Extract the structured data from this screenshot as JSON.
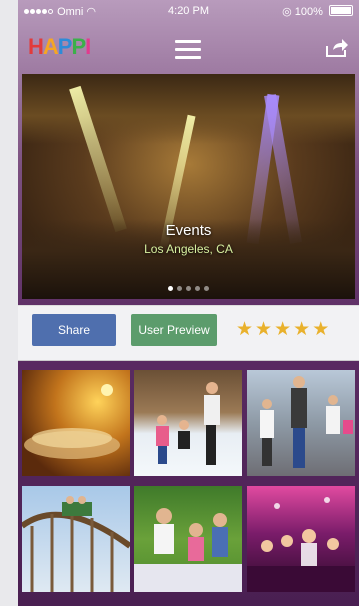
{
  "status": {
    "carrier": "Omni",
    "time": "4:20 PM",
    "battery": "100%"
  },
  "header": {
    "logo_text": "HAPPI",
    "menu_icon": "hamburger-menu-icon",
    "share_icon": "share-arrow-icon"
  },
  "hero": {
    "title": "Events",
    "subtitle": "Los Angeles, CA",
    "page_count": 5,
    "active_page": 1
  },
  "actions": {
    "share_label": "Share",
    "preview_label": "User Preview",
    "rating": 5,
    "star_color": "#e9b12c"
  },
  "gallery": {
    "tiles": [
      {
        "name": "tile-golden-stage"
      },
      {
        "name": "tile-ice-skating"
      },
      {
        "name": "tile-shopping-family"
      },
      {
        "name": "tile-roller-coaster"
      },
      {
        "name": "tile-picnic-family"
      },
      {
        "name": "tile-night-party"
      }
    ]
  },
  "colors": {
    "share_button": "#4f6fae",
    "preview_button": "#5c9c6c",
    "background_top": "#b89bbc",
    "background_bottom": "#4a1f52"
  }
}
